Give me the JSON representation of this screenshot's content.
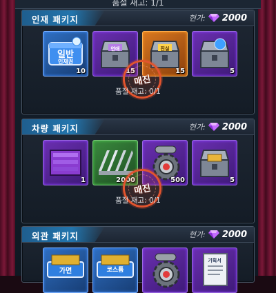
{
  "top_notice": "품절 재고: 1/1",
  "price_label": "현가:",
  "currency_icon": "gem-icon",
  "colors": {
    "accent": "#2275ad",
    "rare": "#6a2fb0",
    "sold_stamp": "#e2542e"
  },
  "panels": [
    {
      "title": "인재 패키지",
      "price": "2000",
      "items": [
        {
          "kind": "ticket",
          "qty": "10",
          "ticket_top": "일반",
          "ticket_bottom": "인재권",
          "icon": "ticket-icon"
        },
        {
          "kind": "chest",
          "qty": "15",
          "chest_label": "연애",
          "icon": "chest-icon"
        },
        {
          "kind": "chest-orange",
          "qty": "15",
          "chest_label": "진실",
          "icon": "chest-icon"
        },
        {
          "kind": "chest-globe",
          "qty": "5",
          "icon": "chest-icon"
        }
      ],
      "sold_label": "매진",
      "stock": "품절 재고: 0/1"
    },
    {
      "title": "차량 패키지",
      "price": "2000",
      "items": [
        {
          "kind": "crate",
          "qty": "1",
          "icon": "crate-icon"
        },
        {
          "kind": "metal",
          "qty": "2000",
          "icon": "metal-bars-icon"
        },
        {
          "kind": "gear",
          "qty": "500",
          "icon": "gear-icon"
        },
        {
          "kind": "chest-gold",
          "qty": "5",
          "icon": "chest-icon"
        }
      ],
      "sold_label": "매진",
      "stock": "품절 재고: 0/1"
    },
    {
      "title": "외관 패키지",
      "price": "2000",
      "items": [
        {
          "kind": "ticket2",
          "qty": "",
          "ticket_top": "가면",
          "icon": "ticket-icon"
        },
        {
          "kind": "ticket3",
          "qty": "",
          "ticket_top": "코스튬",
          "icon": "ticket-icon"
        },
        {
          "kind": "gear",
          "qty": "",
          "icon": "gear-icon"
        },
        {
          "kind": "doc",
          "qty": "",
          "doc_label": "기획서",
          "icon": "document-icon"
        }
      ]
    }
  ]
}
